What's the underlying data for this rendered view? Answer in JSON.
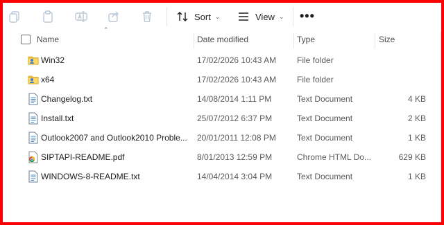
{
  "toolbar": {
    "sort_label": "Sort",
    "view_label": "View",
    "more_label": "•••"
  },
  "columns": {
    "name": "Name",
    "date": "Date modified",
    "type": "Type",
    "size": "Size"
  },
  "files": [
    {
      "name": "Win32",
      "date": "17/02/2026 10:43 AM",
      "type": "File folder",
      "size": "",
      "icon": "folder-user-icon"
    },
    {
      "name": "x64",
      "date": "17/02/2026 10:43 AM",
      "type": "File folder",
      "size": "",
      "icon": "folder-user-icon"
    },
    {
      "name": "Changelog.txt",
      "date": "14/08/2014 1:11 PM",
      "type": "Text Document",
      "size": "4 KB",
      "icon": "text-file-icon"
    },
    {
      "name": "Install.txt",
      "date": "25/07/2012 6:37 PM",
      "type": "Text Document",
      "size": "2 KB",
      "icon": "text-file-icon"
    },
    {
      "name": "Outlook2007 and Outlook2010 Proble...",
      "date": "20/01/2011 12:08 PM",
      "type": "Text Document",
      "size": "1 KB",
      "icon": "text-file-icon"
    },
    {
      "name": "SIPTAPI-README.pdf",
      "date": "8/01/2013 12:59 PM",
      "type": "Chrome HTML Do...",
      "size": "629 KB",
      "icon": "chrome-pdf-icon"
    },
    {
      "name": "WINDOWS-8-README.txt",
      "date": "14/04/2014 3:04 PM",
      "type": "Text Document",
      "size": "1 KB",
      "icon": "text-file-icon"
    }
  ],
  "colors": {
    "border": "#ff0000",
    "icon_disabled": "#b9c7d6"
  }
}
